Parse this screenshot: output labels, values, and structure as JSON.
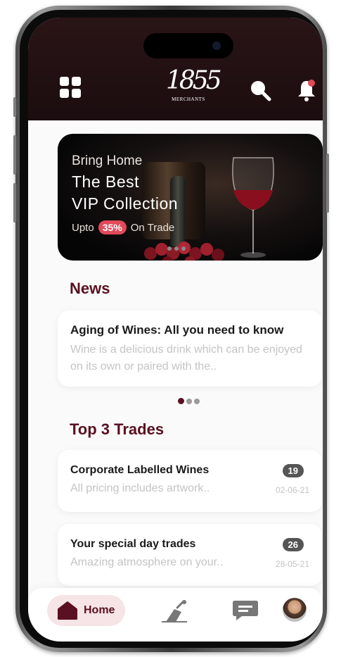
{
  "header": {
    "logo_number": "1855",
    "logo_sub": "MERCHANTS"
  },
  "hero": {
    "line1": "Bring Home",
    "line2": "The Best",
    "line3": "VIP Collection",
    "offer_prefix": "Upto",
    "offer_percent": "35%",
    "offer_suffix": "On Trade"
  },
  "news": {
    "section_title": "News",
    "item": {
      "title": "Aging of Wines: All you need to know",
      "body": "Wine is a delicious drink which can be enjoyed on its own or paired with the.."
    }
  },
  "trades": {
    "section_title": "Top 3 Trades",
    "items": [
      {
        "title": "Corporate Labelled Wines",
        "subtitle": "All pricing includes artwork..",
        "count": "19",
        "date": "02-06-21"
      },
      {
        "title": "Your special day trades",
        "subtitle": "Amazing atmosphere on your..",
        "count": "26",
        "date": "28-05-21"
      }
    ]
  },
  "bottom_nav": {
    "home_label": "Home",
    "icons": [
      "home-icon",
      "wine-pour-icon",
      "chat-icon",
      "avatar"
    ]
  },
  "colors": {
    "brand": "#5a1020",
    "header_bg": "#1b0d0f",
    "accent_badge": "#e14a5a"
  }
}
